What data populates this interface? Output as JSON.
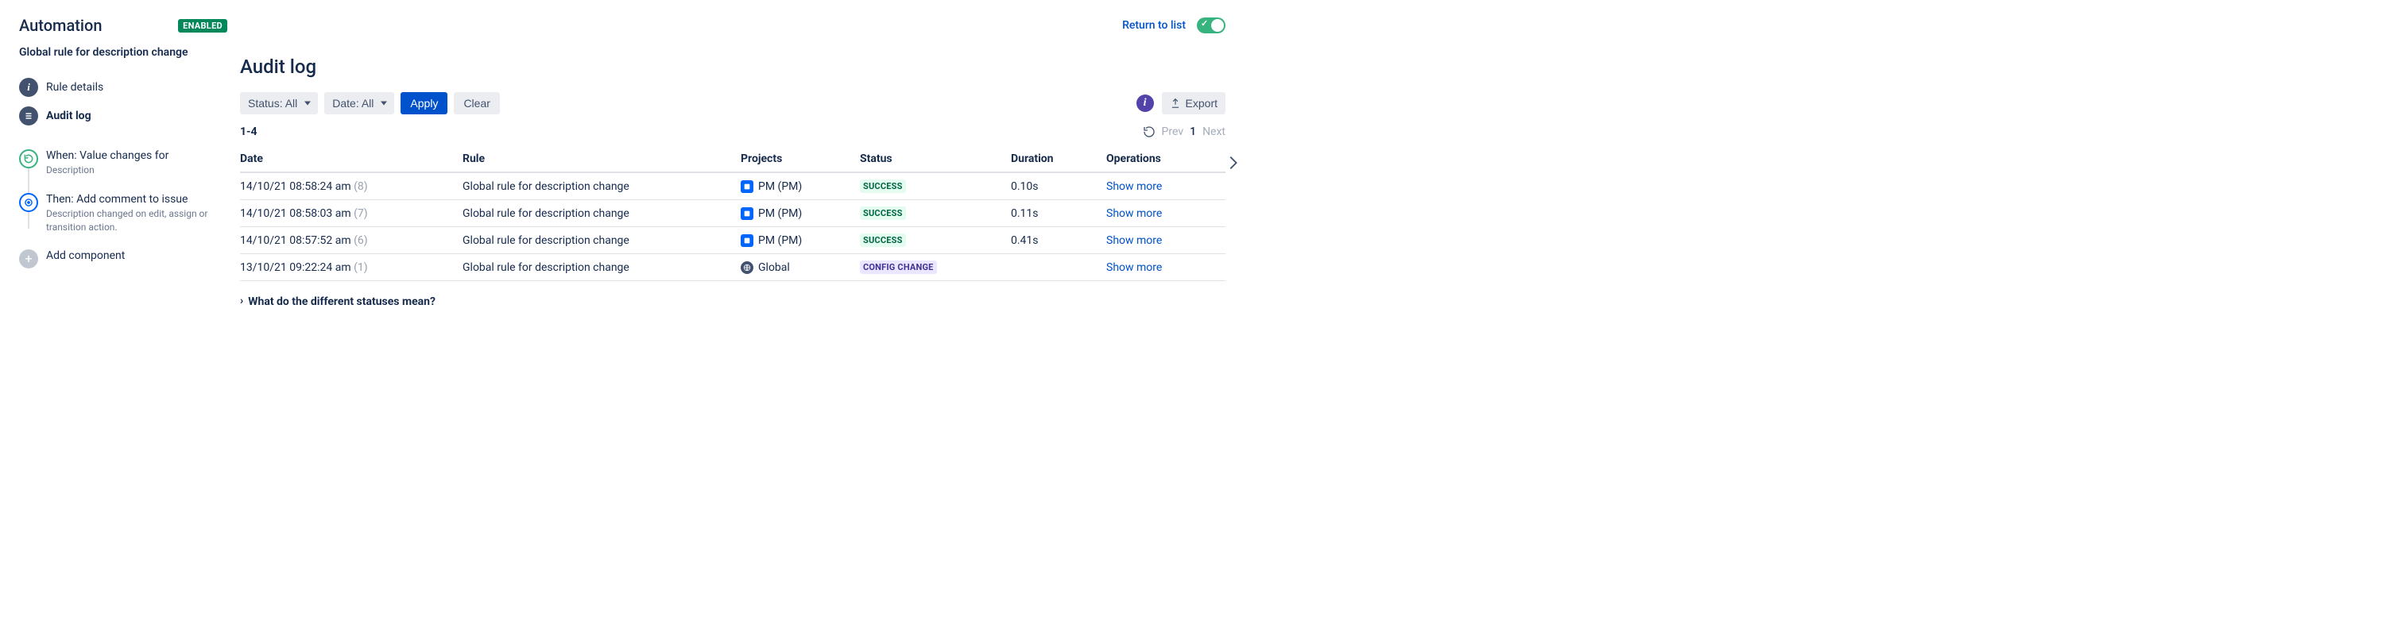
{
  "header": {
    "title": "Automation",
    "enabled_badge": "ENABLED",
    "rule_name": "Global rule for description change",
    "return_link": "Return to list"
  },
  "nav": {
    "details": "Rule details",
    "audit": "Audit log"
  },
  "timeline": {
    "when_title": "When: Value changes for",
    "when_desc": "Description",
    "then_title": "Then: Add comment to issue",
    "then_desc": "Description changed on edit, assign or transition action.",
    "add": "Add component"
  },
  "main": {
    "heading": "Audit log",
    "filters": {
      "status_label": "Status: All",
      "date_label": "Date: All",
      "apply": "Apply",
      "clear": "Clear",
      "export": "Export"
    },
    "range": "1-4",
    "pager": {
      "prev": "Prev",
      "page": "1",
      "next": "Next"
    },
    "columns": {
      "date": "Date",
      "rule": "Rule",
      "projects": "Projects",
      "status": "Status",
      "duration": "Duration",
      "operations": "Operations"
    },
    "rows": [
      {
        "date": "14/10/21 08:58:24 am",
        "count": "(8)",
        "rule": "Global rule for description change",
        "project": "PM (PM)",
        "project_kind": "pm",
        "status": "SUCCESS",
        "status_kind": "success",
        "duration": "0.10s",
        "op": "Show more"
      },
      {
        "date": "14/10/21 08:58:03 am",
        "count": "(7)",
        "rule": "Global rule for description change",
        "project": "PM (PM)",
        "project_kind": "pm",
        "status": "SUCCESS",
        "status_kind": "success",
        "duration": "0.11s",
        "op": "Show more"
      },
      {
        "date": "14/10/21 08:57:52 am",
        "count": "(6)",
        "rule": "Global rule for description change",
        "project": "PM (PM)",
        "project_kind": "pm",
        "status": "SUCCESS",
        "status_kind": "success",
        "duration": "0.41s",
        "op": "Show more"
      },
      {
        "date": "13/10/21 09:22:24 am",
        "count": "(1)",
        "rule": "Global rule for description change",
        "project": "Global",
        "project_kind": "global",
        "status": "CONFIG CHANGE",
        "status_kind": "config",
        "duration": "",
        "op": "Show more"
      }
    ],
    "disclosure": "What do the different statuses mean?"
  }
}
